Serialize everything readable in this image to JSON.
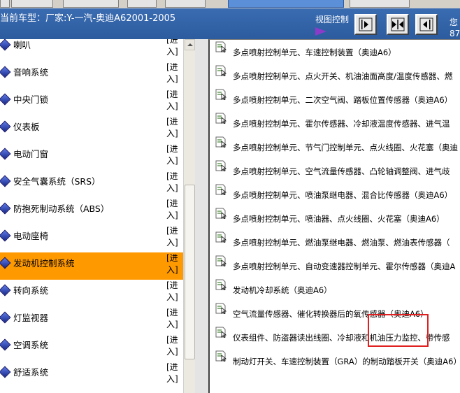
{
  "header": {
    "car_info": "当前车型：厂家:Y-一汽-奥迪A62001-2005",
    "view_control_label": "视图控制",
    "user_label": "您",
    "user_number": "87"
  },
  "categories": [
    {
      "label": "喇叭",
      "enter": "[进入]",
      "active": false
    },
    {
      "label": "音响系统",
      "enter": "[进入]",
      "active": false
    },
    {
      "label": "中央门锁",
      "enter": "[进入]",
      "active": false
    },
    {
      "label": "仪表板",
      "enter": "[进入]",
      "active": false
    },
    {
      "label": "电动门窗",
      "enter": "[进入]",
      "active": false
    },
    {
      "label": "安全气囊系统（SRS）",
      "enter": "[进入]",
      "active": false
    },
    {
      "label": "防抱死制动系统（ABS）",
      "enter": "[进入]",
      "active": false
    },
    {
      "label": "电动座椅",
      "enter": "[进入]",
      "active": false
    },
    {
      "label": "发动机控制系统",
      "enter": "[进入]",
      "active": true
    },
    {
      "label": "转向系统",
      "enter": "[进入]",
      "active": false
    },
    {
      "label": "灯监视器",
      "enter": "[进入]",
      "active": false
    },
    {
      "label": "空调系统",
      "enter": "[进入]",
      "active": false
    },
    {
      "label": "舒适系统",
      "enter": "[进入]",
      "active": false
    }
  ],
  "diagrams": [
    "多点喷射控制单元、车速控制装置（奥迪A6）",
    "多点喷射控制单元、点火开关、机油油面高度/温度传感器、燃",
    "多点喷射控制单元、二次空气阀、踏板位置传感器（奥迪A6）",
    "多点喷射控制单元、霍尔传感器、冷却液温度传感器、进气温",
    "多点喷射控制单元、节气门控制单元、点火线圈、火花塞（奥迪",
    "多点喷射控制单元、空气流量传感器、凸轮轴调整阀、进气歧",
    "多点喷射控制单元、喷油泵继电器、混合比传感器（奥迪A6）",
    "多点喷射控制单元、喷油器、点火线圈、火花塞（奥迪A6）",
    "多点喷射控制单元、燃油泵继电器、燃油泵、燃油表传感器（",
    "多点喷射控制单元、自动变速器控制单元、霍尔传感器（奥迪A",
    "发动机冷却系统（奥迪A6）",
    "空气流量传感器、催化转换器后的氧传感器（奥迪A6）",
    "仪表组件、防盗器读出线圈、冷却液和机油压力监控、带传感",
    "制动灯开关、车速控制装置（GRA）的制动踏板开关（奥迪A6）"
  ],
  "colors": {
    "header_bg": "#3366aa",
    "active_category": "#ff9900",
    "highlight_box": "#e02020",
    "view_arrow": "#8a3cc8"
  },
  "icons": {
    "category": "blue-diamond-icon",
    "diagram": "document-pointer-icon"
  }
}
